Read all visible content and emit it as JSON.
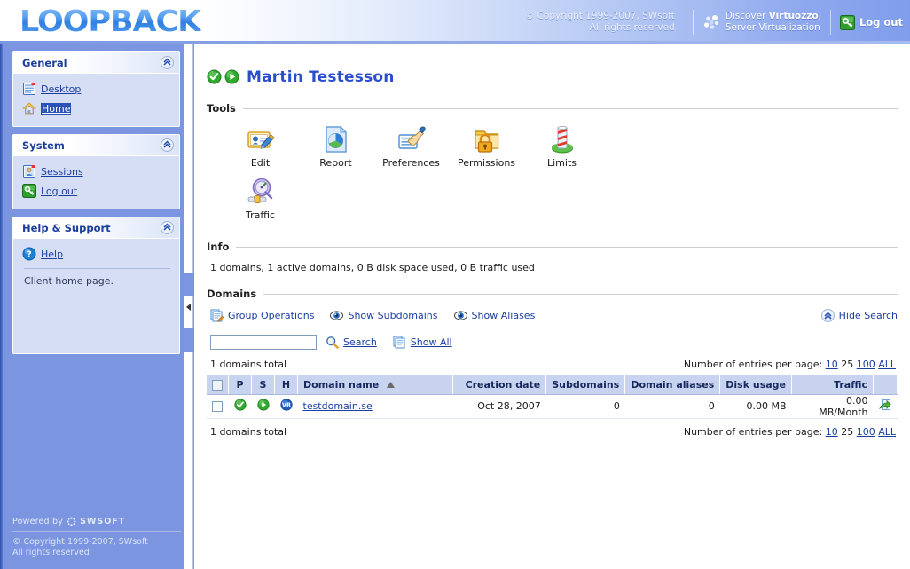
{
  "header": {
    "logo": "LOOPBACK",
    "copyright_line1": "© Copyright 1999-2007, SWsoft",
    "copyright_line2": "All rights reserved",
    "virtuozzo_line1_pre": "Discover ",
    "virtuozzo_line1_strong": "Virtuozzo",
    "virtuozzo_line1_post": ",",
    "virtuozzo_line2": "Server Virtualization",
    "logout_label": "Log out"
  },
  "sidebar": {
    "panels": [
      {
        "title": "General",
        "items": [
          {
            "label": "Desktop",
            "icon": "desktop-icon",
            "selected": false
          },
          {
            "label": "Home",
            "icon": "home-icon",
            "selected": true
          }
        ]
      },
      {
        "title": "System",
        "items": [
          {
            "label": "Sessions",
            "icon": "sessions-icon",
            "selected": false
          },
          {
            "label": "Log out",
            "icon": "key-icon",
            "selected": false
          }
        ]
      },
      {
        "title": "Help & Support",
        "items": [
          {
            "label": "Help",
            "icon": "help-icon",
            "selected": false
          }
        ],
        "note": "Client home page."
      }
    ],
    "footer": {
      "powered_by": "Powered by",
      "brand": "SWSOFT",
      "copyright_line1": "© Copyright 1999-2007, SWsoft",
      "copyright_line2": "All rights reserved"
    }
  },
  "main": {
    "page_title": "Martin Testesson",
    "sections": {
      "tools_label": "Tools",
      "info_label": "Info",
      "domains_label": "Domains"
    },
    "tools": [
      {
        "label": "Edit",
        "icon": "edit-card-icon"
      },
      {
        "label": "Report",
        "icon": "report-icon"
      },
      {
        "label": "Preferences",
        "icon": "preferences-icon"
      },
      {
        "label": "Permissions",
        "icon": "permissions-lock-icon"
      },
      {
        "label": "Limits",
        "icon": "limits-post-icon"
      },
      {
        "label": "Traffic",
        "icon": "traffic-gauge-icon"
      }
    ],
    "info_text": "1 domains, 1 active domains, 0 B disk space used, 0 B traffic used",
    "domain_actions": [
      {
        "label": "Group Operations",
        "icon": "group-operations-icon"
      },
      {
        "label": "Show Subdomains",
        "icon": "eye-icon"
      },
      {
        "label": "Show Aliases",
        "icon": "eye-icon"
      }
    ],
    "hide_search_label": "Hide Search",
    "search": {
      "value": "",
      "placeholder": "",
      "search_label": "Search",
      "show_all_label": "Show All"
    },
    "table": {
      "total_top": "1 domains total",
      "total_bottom": "1 domains total",
      "entries_label": "Number of entries per page:",
      "entries_options": [
        "10",
        "25",
        "100",
        "ALL"
      ],
      "entries_current": "25",
      "columns": [
        {
          "key": "check",
          "label": ""
        },
        {
          "key": "p",
          "label": "P"
        },
        {
          "key": "s",
          "label": "S"
        },
        {
          "key": "h",
          "label": "H"
        },
        {
          "key": "domain_name",
          "label": "Domain name",
          "sorted": "asc"
        },
        {
          "key": "creation_date",
          "label": "Creation date"
        },
        {
          "key": "subdomains",
          "label": "Subdomains"
        },
        {
          "key": "domain_aliases",
          "label": "Domain aliases"
        },
        {
          "key": "disk_usage",
          "label": "Disk usage"
        },
        {
          "key": "traffic",
          "label": "Traffic"
        },
        {
          "key": "action",
          "label": ""
        }
      ],
      "rows": [
        {
          "p_status": "ok",
          "s_status": "running",
          "h_status": "vr",
          "domain_name": "testdomain.se",
          "creation_date": "Oct 28, 2007",
          "subdomains": "0",
          "domain_aliases": "0",
          "disk_usage": "0.00 MB",
          "traffic": "0.00 MB/Month",
          "action_icon": "open-site-icon"
        }
      ]
    }
  },
  "colors": {
    "brand_blue": "#7b95e0",
    "accent_link": "#1b3fa0",
    "title_blue": "#2b4ecf",
    "table_header": "#c8d4ef",
    "status_green": "#3aa02c"
  }
}
